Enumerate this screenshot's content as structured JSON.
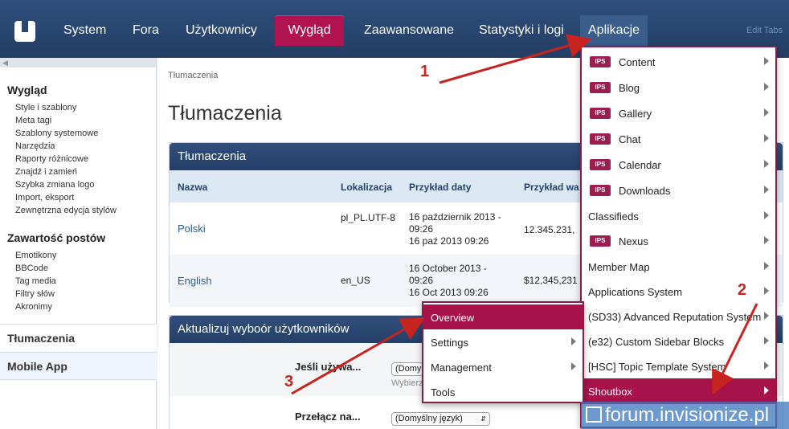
{
  "nav": {
    "tabs": [
      {
        "label": "System"
      },
      {
        "label": "Fora"
      },
      {
        "label": "Użytkownicy"
      },
      {
        "label": "Wygląd"
      },
      {
        "label": "Zaawansowane"
      },
      {
        "label": "Statystyki i logi"
      },
      {
        "label": "Aplikacje"
      }
    ],
    "active_tab": "Wygląd",
    "edit_tabs": "Edit Tabs"
  },
  "sidebar": {
    "sections": [
      {
        "title": "Wygląd",
        "items": [
          "Style i szablony",
          "Meta tagi",
          "Szablony systemowe",
          "Narzędzia",
          "Raporty różnicowe",
          "Znajdź i zamień",
          "Szybka zmiana logo",
          "Import, eksport",
          "Zewnętrzna edycja stylów"
        ]
      },
      {
        "title": "Zawartość postów",
        "items": [
          "Emotikony",
          "BBCode",
          "Tag media",
          "Filtry słów",
          "Akronimy"
        ]
      }
    ],
    "current": "Tłumaczenia",
    "mobile": "Mobile App"
  },
  "main": {
    "breadcrumb": "Tłumaczenia",
    "title": "Tłumaczenia",
    "languages_box": {
      "heading": "Tłumaczenia",
      "columns": [
        "Nazwa",
        "Lokalizacja",
        "Przykład daty",
        "Przykład wa"
      ],
      "rows": [
        {
          "name": "Polski",
          "locale": "pl_PL.UTF-8",
          "date1": "16 październik 2013 - 09:26",
          "date2": "16 paź 2013 09:26",
          "number": "12.345.231,"
        },
        {
          "name": "English",
          "locale": "en_US",
          "date1": "16 October 2013 - 09:26",
          "date2": "16 Oct 2013 09:26",
          "number": "$12,345,231"
        }
      ]
    },
    "update_box": {
      "heading": "Aktualizuj wyboór użytkowników",
      "row1_label": "Jeśli używa...",
      "row1_select": "(Domy",
      "row1_hint": "Wybierz",
      "row2_label": "Przełącz na...",
      "row2_select": "(Domyślny język)"
    }
  },
  "apps_menu": {
    "badge": "IPS",
    "items": [
      {
        "label": "Content",
        "badge": true
      },
      {
        "label": "Blog",
        "badge": true
      },
      {
        "label": "Gallery",
        "badge": true
      },
      {
        "label": "Chat",
        "badge": true
      },
      {
        "label": "Calendar",
        "badge": true
      },
      {
        "label": "Downloads",
        "badge": true
      },
      {
        "label": "Classifieds",
        "badge": false
      },
      {
        "label": "Nexus",
        "badge": true
      },
      {
        "label": "Member Map",
        "badge": false
      },
      {
        "label": "Applications System",
        "badge": false
      },
      {
        "label": "(SD33) Advanced Reputation System",
        "badge": false
      },
      {
        "label": "(e32) Custom Sidebar Blocks",
        "badge": false
      },
      {
        "label": "[HSC] Topic Template System",
        "badge": false
      },
      {
        "label": "Shoutbox",
        "badge": false
      }
    ],
    "selected": "Shoutbox"
  },
  "submenu": {
    "items": [
      {
        "label": "Overview",
        "arrow": false
      },
      {
        "label": "Settings",
        "arrow": true
      },
      {
        "label": "Management",
        "arrow": true
      },
      {
        "label": "Tools",
        "arrow": false
      }
    ],
    "selected": "Overview"
  },
  "annotations": {
    "steps": [
      "1",
      "2",
      "3"
    ],
    "color": "#c7231f"
  },
  "watermark": "forum.invisionize.pl"
}
